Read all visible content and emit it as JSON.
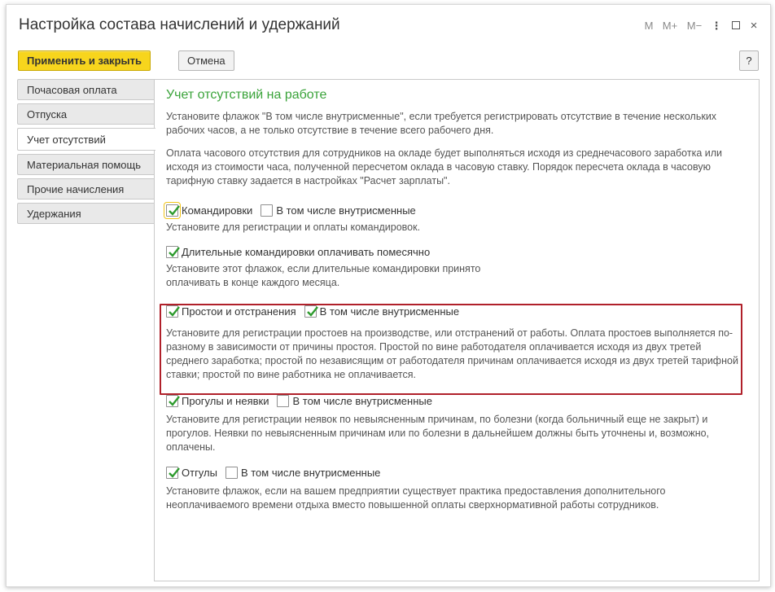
{
  "window": {
    "title": "Настройка состава начислений и удержаний",
    "controls": {
      "m": "M",
      "mplus": "M+",
      "mminus": "M−",
      "more": "⋮",
      "close": "×"
    }
  },
  "toolbar": {
    "apply_label": "Применить и закрыть",
    "cancel_label": "Отмена",
    "help_label": "?"
  },
  "tabs": [
    {
      "label": "Почасовая оплата"
    },
    {
      "label": "Отпуска"
    },
    {
      "label": "Учет отсутствий",
      "active": true
    },
    {
      "label": "Материальная помощь"
    },
    {
      "label": "Прочие начисления"
    },
    {
      "label": "Удержания"
    }
  ],
  "main": {
    "title": "Учет отсутствий на работе",
    "intro1": "Установите флажок \"В том числе внутрисменные\", если требуется регистрировать отсутствие в течение нескольких рабочих часов, а не только отсутствие в течение всего рабочего дня.",
    "intro2": "Оплата часового отсутствия для сотрудников на окладе будет выполняться исходя из среднечасового заработка или исходя из стоимости часа, полученной пересчетом оклада в часовую ставку. Порядок пересчета оклада в часовую тарифную ставку задается в настройках \"Расчет зарплаты\".",
    "trips": {
      "label": "Командировки",
      "checked": true,
      "sub_label": "В том числе внутрисменные",
      "sub_checked": false,
      "note": "Установите для регистрации и оплаты командировок."
    },
    "long_trips": {
      "label": "Длительные командировки оплачивать помесячно",
      "checked": true,
      "note": "Установите этот флажок, если длительные командировки принято оплачивать в конце каждого месяца."
    },
    "downtime": {
      "label": "Простои и отстранения",
      "checked": true,
      "sub_label": "В том числе внутрисменные",
      "sub_checked": true,
      "note": "Установите для регистрации простоев на производстве, или отстранений от работы. Оплата простоев выполняется по-разному в зависимости от причины простоя. Простой по вине работодателя оплачивается исходя из двух третей среднего заработка; простой по независящим от работодателя причинам оплачивается исходя из двух третей тарифной ставки; простой по вине работника не оплачивается."
    },
    "absences": {
      "label": "Прогулы и неявки",
      "checked": true,
      "sub_label": "В том числе внутрисменные",
      "sub_checked": false,
      "note": "Установите для регистрации неявок по невыясненным причинам, по болезни (когда больничный еще не закрыт) и прогулов. Неявки по невыясненным причинам или по болезни в дальнейшем должны быть уточнены и, возможно, оплачены."
    },
    "timeoff": {
      "label": "Отгулы",
      "checked": true,
      "sub_label": "В том числе внутрисменные",
      "sub_checked": false,
      "note": "Установите флажок, если на вашем предприятии существует практика предоставления дополнительного неоплачиваемого времени отдыха вместо повышенной оплаты сверхнормативной работы сотрудников."
    }
  },
  "colors": {
    "accent_yellow": "#f7d51d",
    "section_green": "#3aa33a",
    "check_green": "#2e9b2e",
    "highlight_red": "#b0202a"
  }
}
